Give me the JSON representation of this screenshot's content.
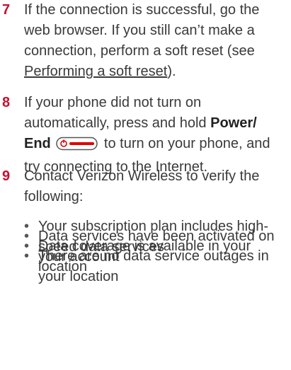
{
  "steps": [
    {
      "number": "7",
      "text_before_link": "If the connection is successful, go the web browser. If you still can’t make a connection, perform a soft reset (see ",
      "link_text": "Performing a soft reset",
      "text_after_link": ")."
    },
    {
      "number": "8",
      "text_part1": "If your phone did not turn on automatically, press and hold ",
      "bold_text": "Power/ End",
      "text_part2": " to turn on your phone, and try connecting to the Internet.",
      "icon": "power-end-key-icon"
    },
    {
      "number": "9",
      "text": "Contact Verizon Wireless to verify the following:"
    }
  ],
  "bullets": [
    "Your subscription plan includes high-speed data services",
    "Data services have been activated on your account",
    "Data coverage is available in your location",
    "There are no data service outages in your location"
  ],
  "colors": {
    "step_number": "#c8102e",
    "body_text": "#3a3a3a",
    "icon_red": "#e00000"
  }
}
